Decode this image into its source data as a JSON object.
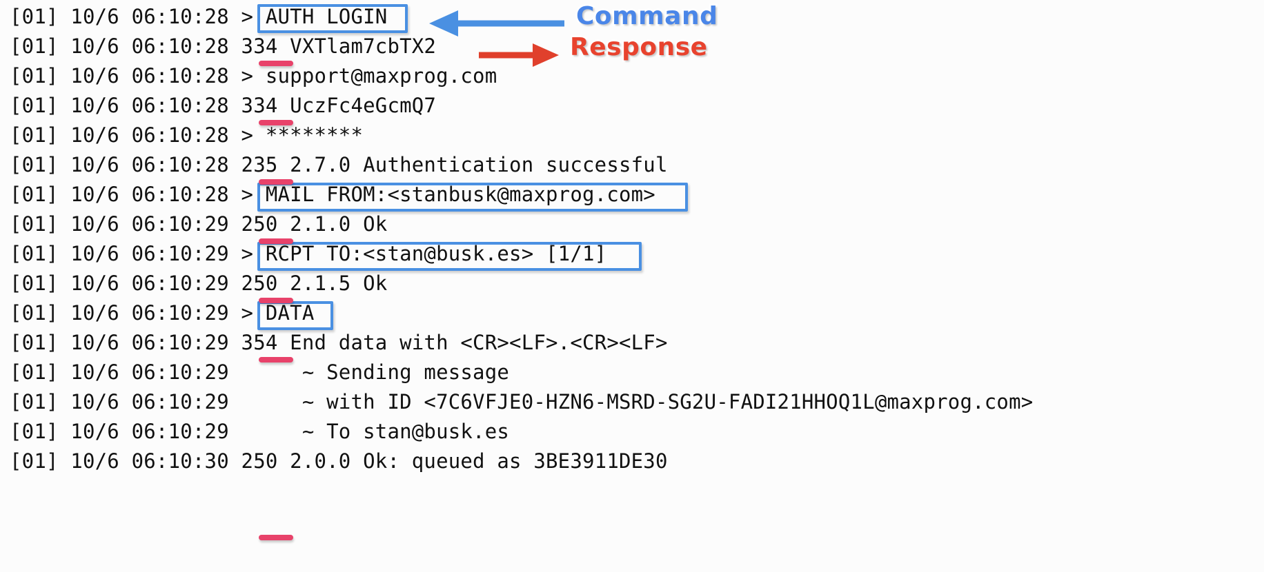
{
  "meta": {
    "title": "SMTP Session Log",
    "colors": {
      "command_box": "#4a90e2",
      "command_label": "#4a86e8",
      "response_arrow": "#e0402c",
      "response_label": "#e8432e",
      "code_underline": "#e8426a",
      "text": "#111111",
      "background": "#fcfcfc"
    }
  },
  "legend": {
    "command": {
      "label": "Command",
      "arrow_icon": "arrow-left-icon",
      "direction": "left"
    },
    "response": {
      "label": "Response",
      "arrow_icon": "arrow-right-icon",
      "direction": "right"
    }
  },
  "log": {
    "lines": [
      {
        "prefix": "[01] 10/6 06:10:28 ",
        "body": "> AUTH LOGIN",
        "kind": "command",
        "boxed": true,
        "code": ""
      },
      {
        "prefix": "[01] 10/6 06:10:28 ",
        "body": "334 VXTlam7cbTX2",
        "kind": "response",
        "boxed": false,
        "code": "334"
      },
      {
        "prefix": "[01] 10/6 06:10:28 ",
        "body": "> support@maxprog.com",
        "kind": "command",
        "boxed": false,
        "code": ""
      },
      {
        "prefix": "[01] 10/6 06:10:28 ",
        "body": "334 UczFc4eGcmQ7",
        "kind": "response",
        "boxed": false,
        "code": "334"
      },
      {
        "prefix": "[01] 10/6 06:10:28 ",
        "body": "> ********",
        "kind": "command",
        "boxed": false,
        "code": ""
      },
      {
        "prefix": "[01] 10/6 06:10:28 ",
        "body": "235 2.7.0 Authentication successful",
        "kind": "response",
        "boxed": false,
        "code": "235"
      },
      {
        "prefix": "[01] 10/6 06:10:28 ",
        "body": "> MAIL FROM:<stanbusk@maxprog.com>",
        "kind": "command",
        "boxed": true,
        "code": ""
      },
      {
        "prefix": "[01] 10/6 06:10:29 ",
        "body": "250 2.1.0 Ok",
        "kind": "response",
        "boxed": false,
        "code": "250"
      },
      {
        "prefix": "[01] 10/6 06:10:29 ",
        "body": "> RCPT TO:<stan@busk.es> [1/1]",
        "kind": "command",
        "boxed": true,
        "code": ""
      },
      {
        "prefix": "[01] 10/6 06:10:29 ",
        "body": "250 2.1.5 Ok",
        "kind": "response",
        "boxed": false,
        "code": "250"
      },
      {
        "prefix": "[01] 10/6 06:10:29 ",
        "body": "> DATA",
        "kind": "command",
        "boxed": true,
        "code": ""
      },
      {
        "prefix": "[01] 10/6 06:10:29 ",
        "body": "354 End data with <CR><LF>.<CR><LF>",
        "kind": "response",
        "boxed": false,
        "code": "354"
      },
      {
        "prefix": "[01] 10/6 06:10:29 ",
        "body": "     ~ Sending message",
        "kind": "info",
        "boxed": false,
        "code": ""
      },
      {
        "prefix": "[01] 10/6 06:10:29 ",
        "body": "     ~ with ID <7C6VFJE0-HZN6-MSRD-SG2U-FADI21HHOQ1L@maxprog.com>",
        "kind": "info",
        "boxed": false,
        "code": ""
      },
      {
        "prefix": "[01] 10/6 06:10:29 ",
        "body": "     ~ To stan@busk.es",
        "kind": "info",
        "boxed": false,
        "code": ""
      },
      {
        "prefix": "[01] 10/6 06:10:30 ",
        "body": "250 2.0.0 Ok: queued as 3BE3911DE30",
        "kind": "response",
        "boxed": false,
        "code": "250"
      }
    ]
  }
}
